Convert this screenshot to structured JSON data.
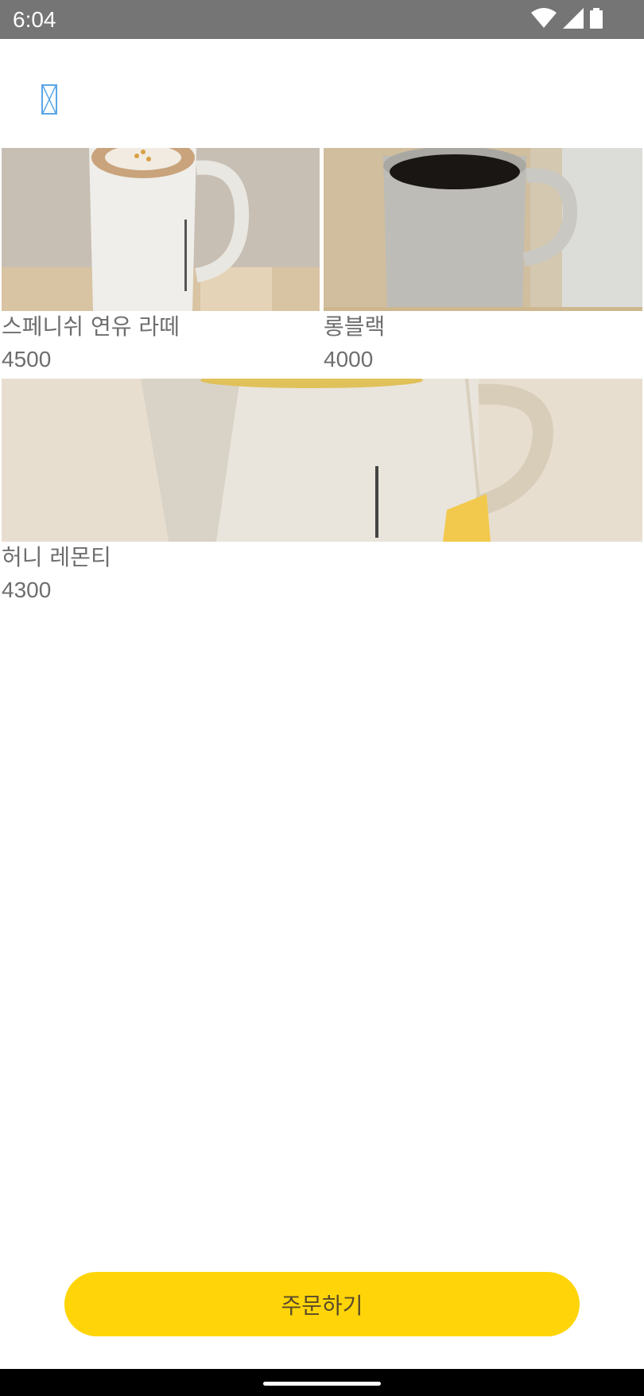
{
  "status_bar": {
    "time": "6:04",
    "icons": [
      "wifi-icon",
      "signal-icon",
      "battery-icon"
    ]
  },
  "header": {
    "image_icon": "broken-image-icon"
  },
  "menu": {
    "items": [
      {
        "name": "스페니쉬 연유 라떼",
        "price": "4500"
      },
      {
        "name": "롱블랙",
        "price": "4000"
      },
      {
        "name": "허니 레몬티",
        "price": "4300"
      }
    ]
  },
  "order_button": {
    "label": "주문하기"
  },
  "colors": {
    "status_bar": "#757575",
    "accent": "#ffd509",
    "text": "#6e6e6e",
    "nav_bar": "#000000"
  }
}
